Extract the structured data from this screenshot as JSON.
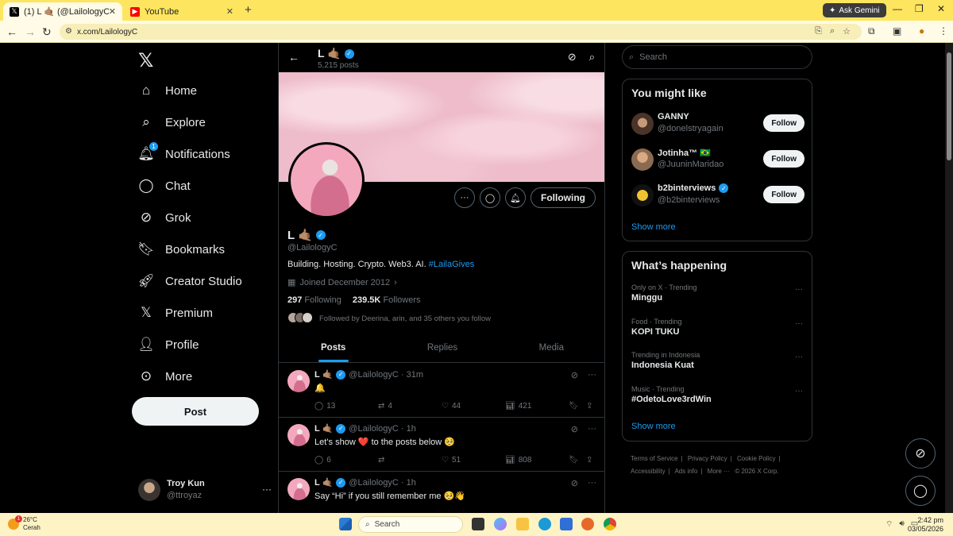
{
  "browser": {
    "tabs": [
      {
        "title": "(1) L 🤙🏽 (@LailologyC) / X",
        "close": "✕"
      },
      {
        "title": "YouTube",
        "close": "✕"
      }
    ],
    "new_tab": "+",
    "ask_gemini": "Ask Gemini",
    "url": "x.com/LailologyC"
  },
  "nav": {
    "items": [
      {
        "label": "Home",
        "icon": "home-icon"
      },
      {
        "label": "Explore",
        "icon": "search-icon"
      },
      {
        "label": "Notifications",
        "icon": "bell-icon",
        "badge": "1"
      },
      {
        "label": "Chat",
        "icon": "chat-icon"
      },
      {
        "label": "Grok",
        "icon": "grok-icon"
      },
      {
        "label": "Bookmarks",
        "icon": "bookmark-icon"
      },
      {
        "label": "Creator Studio",
        "icon": "rocket-icon"
      },
      {
        "label": "Premium",
        "icon": "x-icon"
      },
      {
        "label": "Profile",
        "icon": "person-icon"
      },
      {
        "label": "More",
        "icon": "more-circle-icon"
      }
    ],
    "post_label": "Post",
    "account": {
      "name": "Troy Kun",
      "handle": "@ttroyaz",
      "more": "···"
    }
  },
  "header": {
    "name": "L 🤙🏽",
    "post_count": "5,215 posts"
  },
  "profile": {
    "name": "L 🤙🏽",
    "handle": "@LailologyC",
    "bio_text": "Building. Hosting. Crypto. Web3. AI. ",
    "bio_tag": "#LailaGives",
    "joined": "Joined December 2012",
    "following_count": "297",
    "following_label": "Following",
    "followers_count": "239.5K",
    "followers_label": "Followers",
    "followed_by": "Followed by Deerina, arin, and 35 others you follow",
    "following_button": "Following"
  },
  "tabs": [
    "Posts",
    "Replies",
    "Media"
  ],
  "posts": [
    {
      "name": "L 🤙🏽",
      "handle": "@LailologyC · 31m",
      "text": "🔔",
      "replies": "13",
      "reposts": "4",
      "likes": "44",
      "views": "421"
    },
    {
      "name": "L 🤙🏽",
      "handle": "@LailologyC · 1h",
      "text": "Let’s show ❤️ to the posts below 🥺",
      "replies": "6",
      "reposts": "",
      "likes": "51",
      "views": "808"
    },
    {
      "name": "L 🤙🏽",
      "handle": "@LailologyC · 1h",
      "text": "Say “Hi” if you still remember me 🥺👋",
      "replies": "",
      "reposts": "",
      "likes": "",
      "views": ""
    }
  ],
  "right": {
    "search_placeholder": "Search",
    "might_like_title": "You might like",
    "suggestions": [
      {
        "name": "GANNY",
        "handle": "@donelstryagain",
        "button": "Follow",
        "color": "#6b4a3a"
      },
      {
        "name": "Jotinha™ 🇧🇷",
        "handle": "@JuuninMaridao",
        "button": "Follow",
        "color": "#b98a66"
      },
      {
        "name": "b2binterviews",
        "handle": "@b2binterviews",
        "button": "Follow",
        "color": "#f2c230"
      }
    ],
    "show_more": "Show more",
    "happening_title": "What’s happening",
    "trends": [
      {
        "context": "Only on X · Trending",
        "name": "Minggu"
      },
      {
        "context": "Food · Trending",
        "name": "KOPI TUKU"
      },
      {
        "context": "Trending in Indonesia",
        "name": "Indonesia Kuat"
      },
      {
        "context": "Music · Trending",
        "name": "#OdetoLove3rdWin"
      }
    ],
    "show_more_2": "Show more",
    "footer": [
      "Terms of Service",
      "|",
      "Privacy Policy",
      "|",
      "Cookie Policy",
      "|",
      "Accessibility",
      "|",
      "Ads info",
      "|",
      "More ···",
      "© 2026 X Corp."
    ]
  },
  "taskbar": {
    "temp": "26°C",
    "condition": "Cerah",
    "weather_badge": "1",
    "search": "Search",
    "time": "2:42 pm",
    "date": "03/05/2026"
  },
  "colors": {
    "accent": "#1d9bf0",
    "tabbar": "#fde55f"
  }
}
